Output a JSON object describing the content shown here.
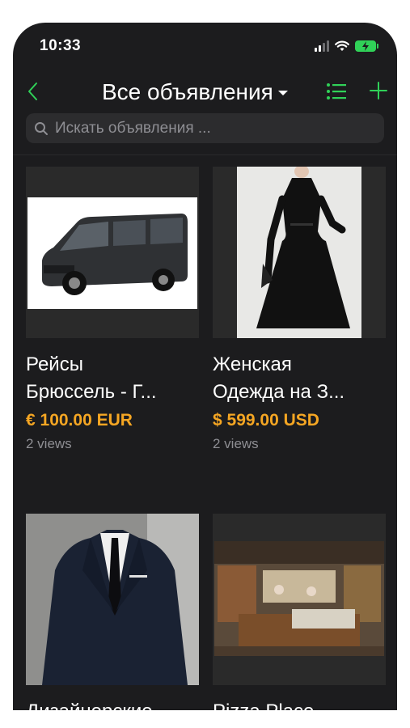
{
  "status": {
    "time": "10:33"
  },
  "nav": {
    "title": "Все объявления"
  },
  "search": {
    "placeholder": "Искать объявления ..."
  },
  "listings": [
    {
      "title_line1": "Рейсы",
      "title_line2": "Брюссель - Г...",
      "price": "€ 100.00 EUR",
      "views": "2 views",
      "image": "black-van"
    },
    {
      "title_line1": "Женская",
      "title_line2": "Одежда на З...",
      "price": "$ 599.00 USD",
      "views": "2 views",
      "image": "black-dress"
    },
    {
      "title_line1": "Дизайнерские",
      "title_line2": "",
      "price": "",
      "views": "",
      "image": "suit"
    },
    {
      "title_line1": "Pizza Place",
      "title_line2": "",
      "price": "",
      "views": "",
      "image": "pizza-shop"
    }
  ],
  "colors": {
    "accent": "#30d158",
    "price": "#f5a623",
    "background": "#1c1c1e"
  }
}
